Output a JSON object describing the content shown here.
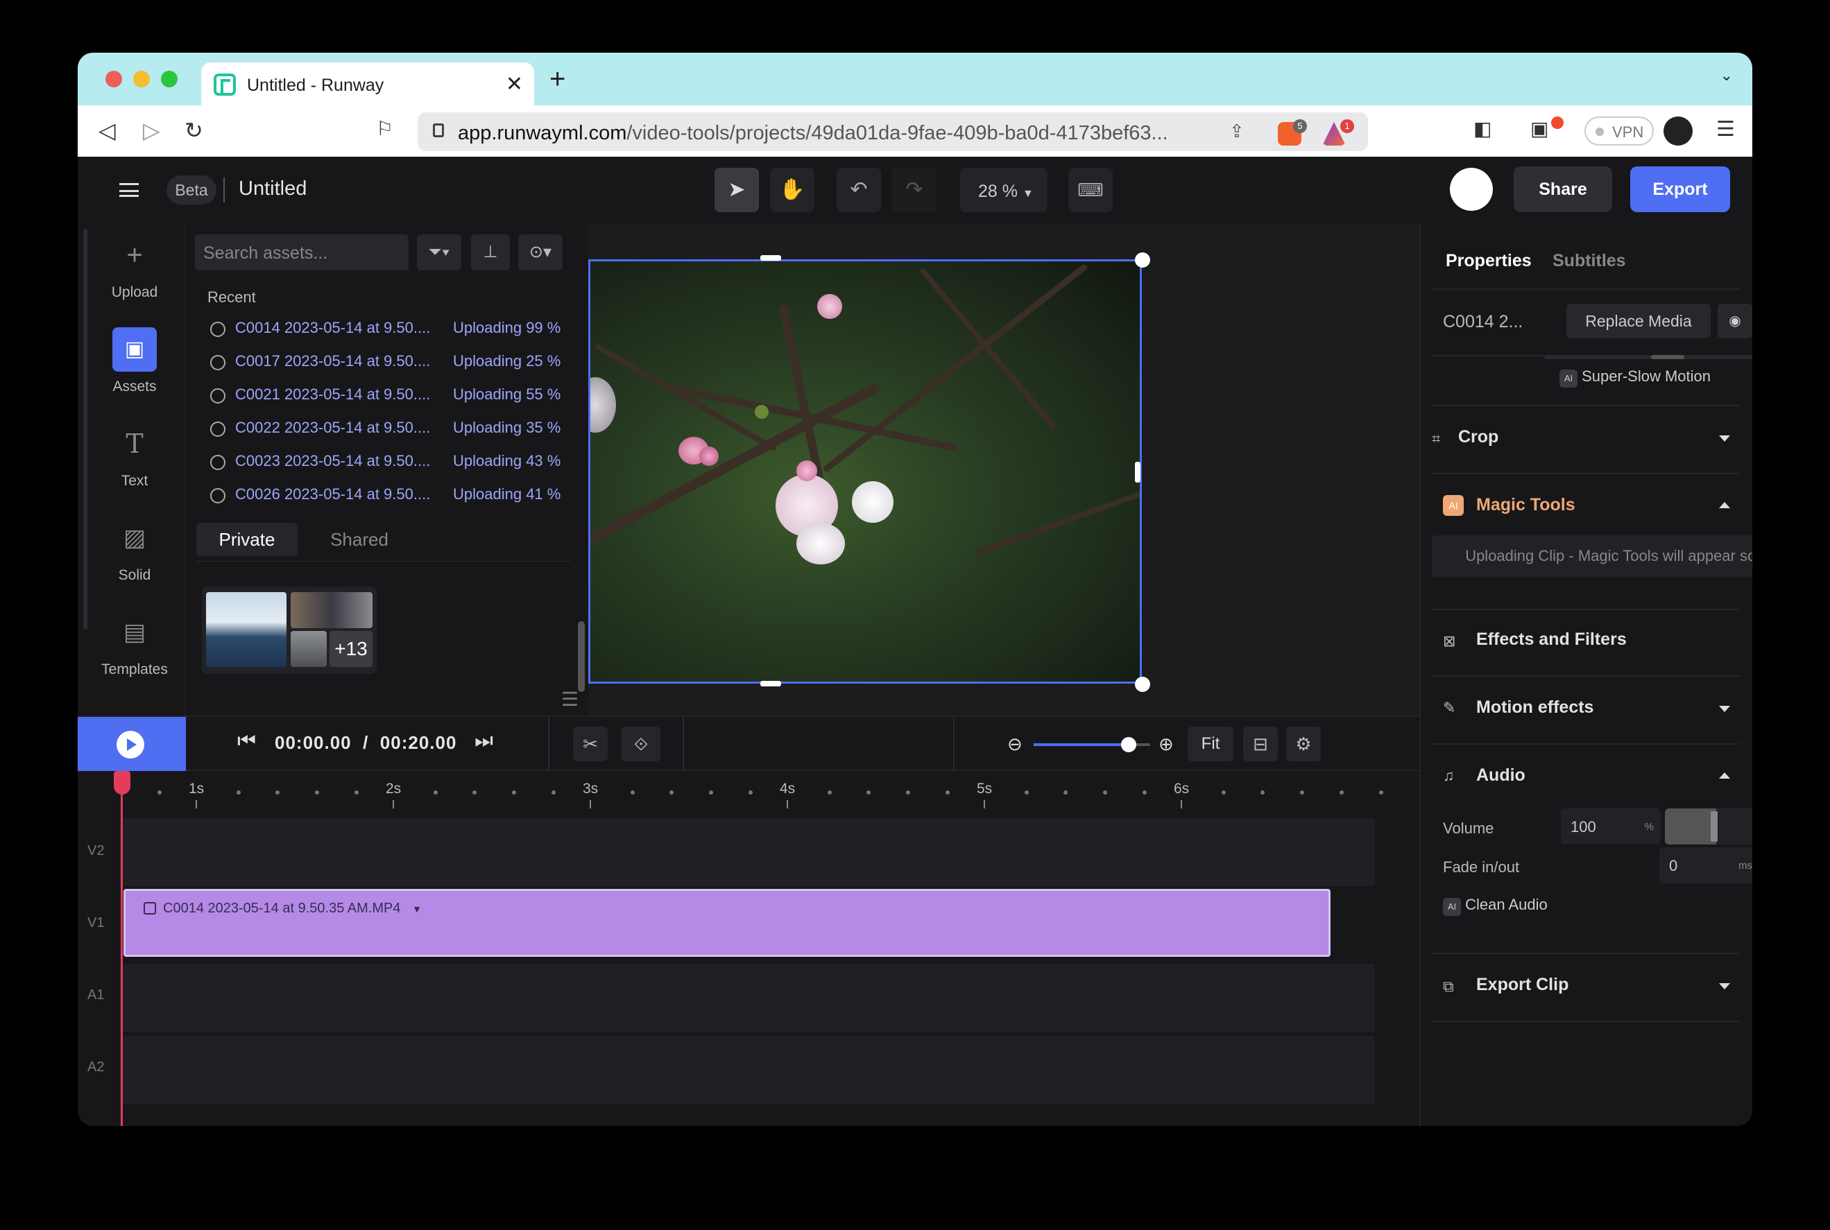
{
  "browser": {
    "tab_title": "Untitled - Runway",
    "url_host": "app.runwayml.com",
    "url_path": "/video-tools/projects/49da01da-9fae-409b-ba0d-4173bef63...",
    "shield_badge": "5",
    "alert_badge": "1",
    "vpn_label": "VPN"
  },
  "header": {
    "beta": "Beta",
    "project_name": "Untitled",
    "zoom": "28 %",
    "share": "Share",
    "export": "Export"
  },
  "rail": {
    "upload": "Upload",
    "assets": "Assets",
    "text": "Text",
    "solid": "Solid",
    "templates": "Templates"
  },
  "assets": {
    "search_placeholder": "Search assets...",
    "recent": "Recent",
    "items": [
      {
        "name": "C0014 2023-05-14 at 9.50....",
        "status": "Uploading 99 %"
      },
      {
        "name": "C0017 2023-05-14 at 9.50....",
        "status": "Uploading 25 %"
      },
      {
        "name": "C0021 2023-05-14 at 9.50....",
        "status": "Uploading 55 %"
      },
      {
        "name": "C0022 2023-05-14 at 9.50....",
        "status": "Uploading 35 %"
      },
      {
        "name": "C0023 2023-05-14 at 9.50....",
        "status": "Uploading 43 %"
      },
      {
        "name": "C0026 2023-05-14 at 9.50....",
        "status": "Uploading 41 %"
      }
    ],
    "tab_private": "Private",
    "tab_shared": "Shared",
    "folder_more": "+13"
  },
  "props": {
    "tab_properties": "Properties",
    "tab_subtitles": "Subtitles",
    "clip_name": "C0014 2...",
    "replace_media": "Replace Media",
    "super_slow": "Super-Slow Motion",
    "ai_badge": "AI",
    "crop": "Crop",
    "magic_tools": "Magic Tools",
    "magic_msg": "Uploading Clip - Magic Tools will appear soon.",
    "effects": "Effects and Filters",
    "motion": "Motion effects",
    "audio": "Audio",
    "volume_label": "Volume",
    "volume_value": "100",
    "volume_unit": "%",
    "fade_label": "Fade in/out",
    "fade_value": "0",
    "fade_unit": "ms",
    "clean_audio": "Clean Audio",
    "export_clip": "Export Clip"
  },
  "transport": {
    "current": "00:00.00",
    "divider": "/",
    "total": "00:20.00",
    "fit": "Fit"
  },
  "timeline": {
    "ruler": [
      "1s",
      "2s",
      "3s",
      "4s",
      "5s",
      "6s"
    ],
    "tracks": [
      "V2",
      "V1",
      "A1",
      "A2"
    ],
    "clip_name": "C0014 2023-05-14 at 9.50.35 AM.MP4"
  },
  "colors": {
    "accent": "#4f6ef2",
    "clip": "#b48ae6",
    "playhead": "#e33c5c",
    "magic": "#f0a774"
  }
}
